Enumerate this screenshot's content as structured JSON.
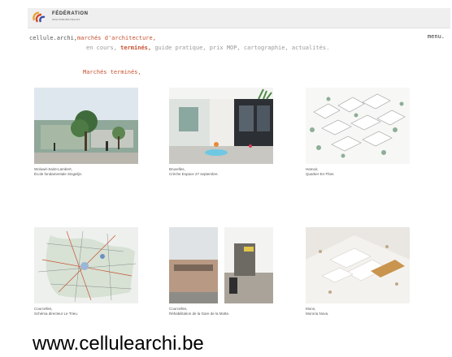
{
  "header": {
    "logo_text": "FÉDÉRATION",
    "logo_sub": "WALLONIE-BRUXELLES"
  },
  "nav": {
    "site": "cellule.archi,",
    "primary": "marchés d'architecture,",
    "secondary": [
      {
        "label": "en cours,",
        "active": false
      },
      {
        "label": "terminés,",
        "active": true
      },
      {
        "label": "guide pratique,",
        "active": false
      },
      {
        "label": "prix MOP,",
        "active": false
      },
      {
        "label": "cartographie,",
        "active": false
      },
      {
        "label": "actualités.",
        "active": false
      }
    ]
  },
  "menu_label": "menu.",
  "section_title": "Marchés terminés,",
  "projects": [
    {
      "line1": "Woluwé-Saint-Lambert,",
      "line2": "École fondamentale Singelijn."
    },
    {
      "line1": "Bruxelles,",
      "line2": "Crèche Espace 27 septembre."
    },
    {
      "line1": "Hamoir,",
      "line2": "Quartier Es-Thier."
    },
    {
      "line1": "Courcelles,",
      "line2": "Schéma directeur Le Trieu."
    },
    {
      "line1": "Courcelles,",
      "line2": "Réhabilitation de la Gare de la Motte."
    },
    {
      "line1": "Mons,",
      "line2": "Mororia Nova."
    }
  ],
  "footer_url": "www.cellulearchi.be",
  "colors": {
    "accent": "#c7512f",
    "muted": "#999999",
    "topbar": "#efefef"
  }
}
